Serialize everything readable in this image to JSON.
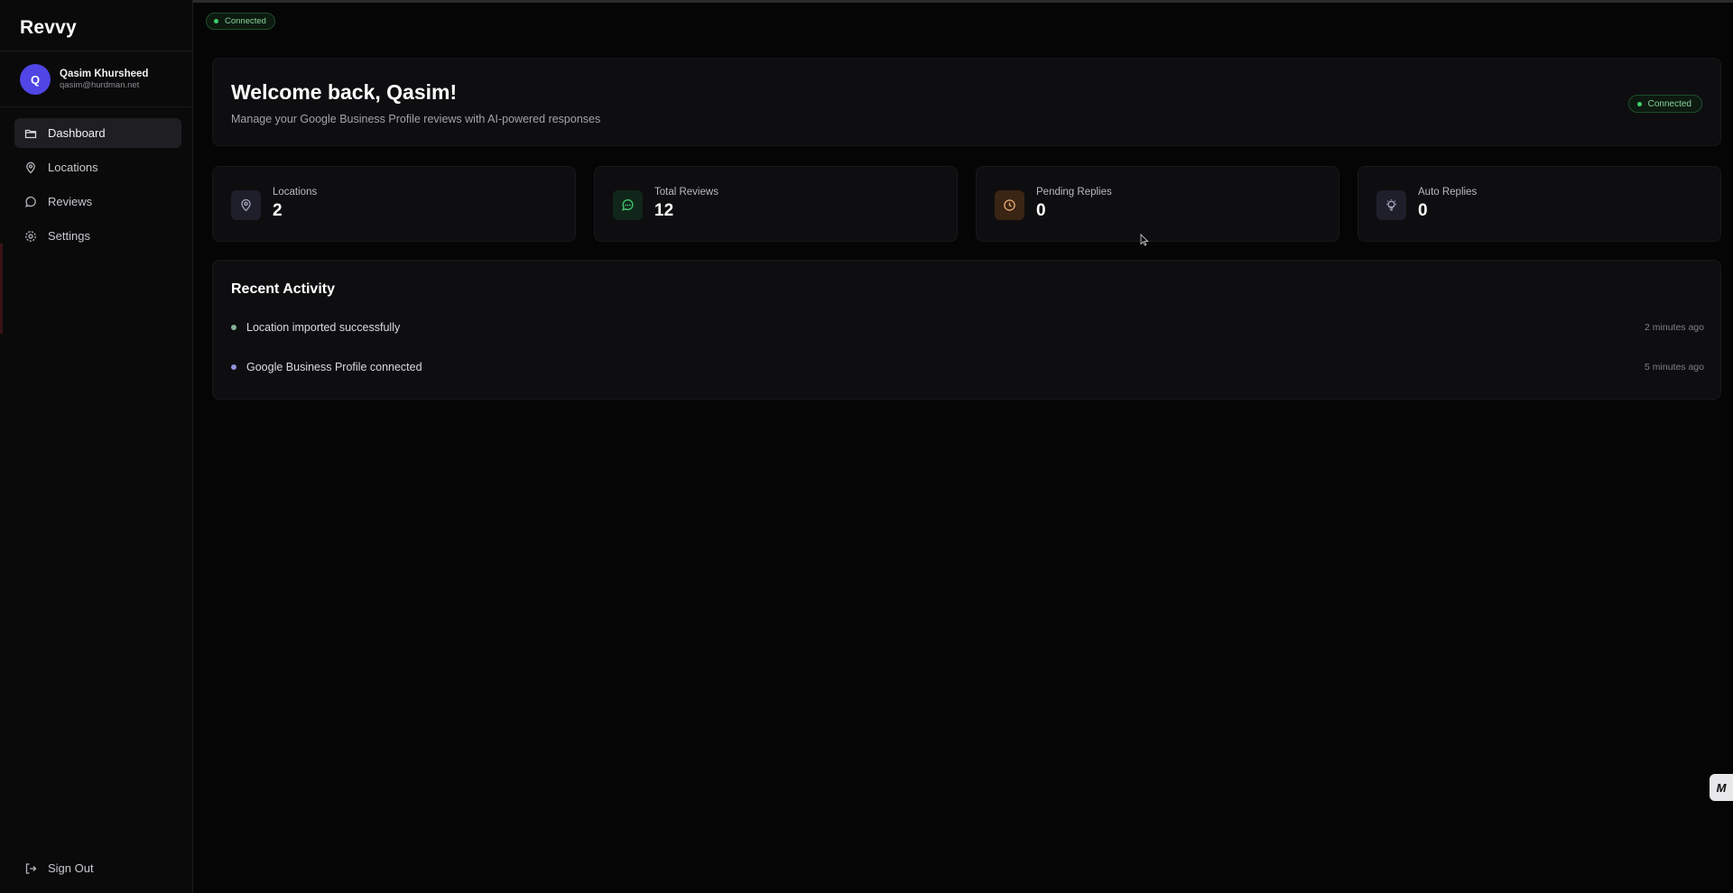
{
  "app": {
    "name": "Revvy"
  },
  "user": {
    "initial": "Q",
    "name": "Qasim Khursheed",
    "email": "qasim@hurdman.net"
  },
  "sidebar": {
    "items": [
      {
        "label": "Dashboard",
        "icon": "folder-icon",
        "active": true
      },
      {
        "label": "Locations",
        "icon": "map-pin-icon",
        "active": false
      },
      {
        "label": "Reviews",
        "icon": "message-circle-icon",
        "active": false
      },
      {
        "label": "Settings",
        "icon": "gear-icon",
        "active": false
      }
    ],
    "sign_out": "Sign Out"
  },
  "status": {
    "label": "Connected",
    "color": "#3fd16b"
  },
  "welcome": {
    "title": "Welcome back, Qasim!",
    "subtitle": "Manage your Google Business Profile reviews with AI-powered responses",
    "badge": "Connected"
  },
  "stats": [
    {
      "label": "Locations",
      "value": "2",
      "icon": "map-pin-icon",
      "color": "#8a8aa0"
    },
    {
      "label": "Total Reviews",
      "value": "12",
      "icon": "message-circle-icon",
      "color": "#3fbf6a"
    },
    {
      "label": "Pending Replies",
      "value": "0",
      "icon": "clock-icon",
      "color": "#d9a26a"
    },
    {
      "label": "Auto Replies",
      "value": "0",
      "icon": "bulb-icon",
      "color": "#9a9ab0"
    }
  ],
  "activity": {
    "title": "Recent Activity",
    "items": [
      {
        "text": "Location imported successfully",
        "time": "2 minutes ago",
        "dot_color": "#86b39a"
      },
      {
        "text": "Google Business Profile connected",
        "time": "5 minutes ago",
        "dot_color": "#8f8fd6"
      }
    ]
  }
}
